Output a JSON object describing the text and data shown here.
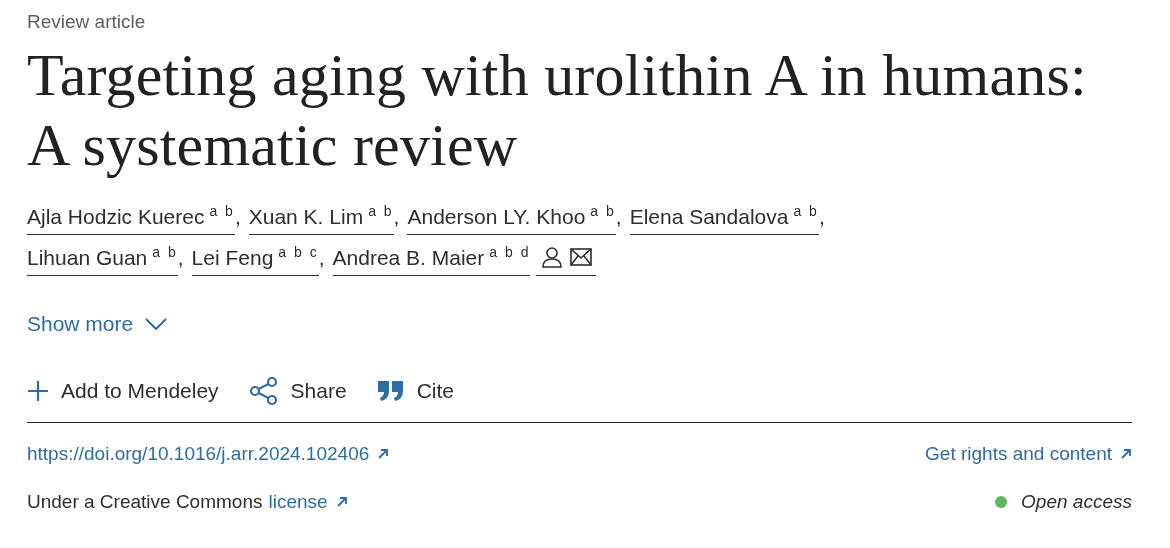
{
  "article_type": "Review article",
  "title": "Targeting aging with urolithin A in humans: A systematic review",
  "authors": [
    {
      "name": "Ajla Hodzic Kuerec",
      "affiliations": "a b"
    },
    {
      "name": "Xuan K. Lim",
      "affiliations": "a b"
    },
    {
      "name": "Anderson LY. Khoo",
      "affiliations": "a b"
    },
    {
      "name": "Elena Sandalova",
      "affiliations": "a b"
    },
    {
      "name": "Lihuan Guan",
      "affiliations": "a b"
    },
    {
      "name": "Lei Feng",
      "affiliations": "a b c"
    },
    {
      "name": "Andrea B. Maier",
      "affiliations": "a b d",
      "corresponding": true
    }
  ],
  "separator": ",",
  "show_more": "Show more",
  "actions": [
    {
      "kind": "add",
      "label": "Add to Mendeley"
    },
    {
      "kind": "share",
      "label": "Share"
    },
    {
      "kind": "cite",
      "label": "Cite"
    }
  ],
  "doi": "https://doi.org/10.1016/j.arr.2024.102406",
  "rights": "Get rights and content",
  "license_prefix": "Under a Creative Commons",
  "license_link": "license",
  "access": {
    "label": "Open access",
    "color": "#5cb85c"
  }
}
